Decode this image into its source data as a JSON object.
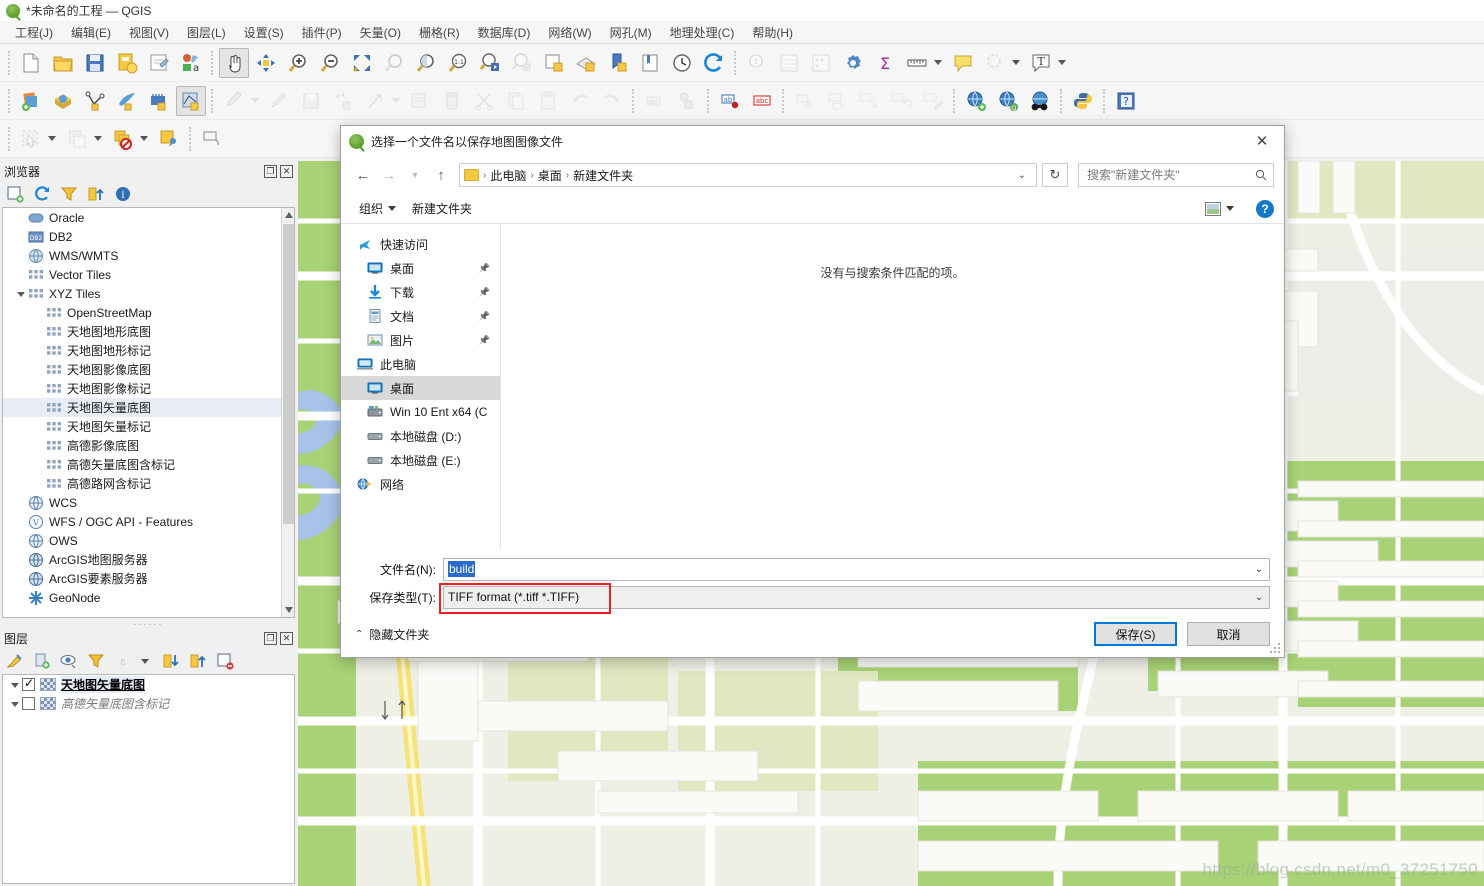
{
  "window": {
    "title": "*未命名的工程 — QGIS",
    "logo_icon": "qgis-logo-icon"
  },
  "menubar": {
    "items": [
      {
        "label": "工程(J)"
      },
      {
        "label": "编辑(E)"
      },
      {
        "label": "视图(V)"
      },
      {
        "label": "图层(L)"
      },
      {
        "label": "设置(S)"
      },
      {
        "label": "插件(P)"
      },
      {
        "label": "矢量(O)"
      },
      {
        "label": "栅格(R)"
      },
      {
        "label": "数据库(D)"
      },
      {
        "label": "网络(W)"
      },
      {
        "label": "网孔(M)"
      },
      {
        "label": "地理处理(C)"
      },
      {
        "label": "帮助(H)"
      }
    ]
  },
  "browser_panel": {
    "title": "浏览器",
    "tools": [
      "add-layer-icon",
      "refresh-icon",
      "filter-icon",
      "collapse-all-icon",
      "info-icon"
    ],
    "items": [
      {
        "label": "Oracle",
        "icon": "oracle-icon",
        "depth": 1,
        "selected": false
      },
      {
        "label": "DB2",
        "icon": "db2-icon",
        "depth": 1,
        "selected": false
      },
      {
        "label": "WMS/WMTS",
        "icon": "wms-icon",
        "depth": 1,
        "selected": false
      },
      {
        "label": "Vector Tiles",
        "icon": "tiles-icon",
        "depth": 1,
        "selected": false
      },
      {
        "label": "XYZ Tiles",
        "icon": "tiles-icon",
        "depth": 1,
        "selected": false,
        "expanded": true
      },
      {
        "label": "OpenStreetMap",
        "icon": "tiles-icon",
        "depth": 2,
        "selected": false
      },
      {
        "label": "天地图地形底图",
        "icon": "tiles-icon",
        "depth": 2,
        "selected": false
      },
      {
        "label": "天地图地形标记",
        "icon": "tiles-icon",
        "depth": 2,
        "selected": false
      },
      {
        "label": "天地图影像底图",
        "icon": "tiles-icon",
        "depth": 2,
        "selected": false
      },
      {
        "label": "天地图影像标记",
        "icon": "tiles-icon",
        "depth": 2,
        "selected": false
      },
      {
        "label": "天地图矢量底图",
        "icon": "tiles-icon",
        "depth": 2,
        "selected": true
      },
      {
        "label": "天地图矢量标记",
        "icon": "tiles-icon",
        "depth": 2,
        "selected": false
      },
      {
        "label": "高德影像底图",
        "icon": "tiles-icon",
        "depth": 2,
        "selected": false
      },
      {
        "label": "高德矢量底图含标记",
        "icon": "tiles-icon",
        "depth": 2,
        "selected": false
      },
      {
        "label": "高德路网含标记",
        "icon": "tiles-icon",
        "depth": 2,
        "selected": false
      },
      {
        "label": "WCS",
        "icon": "globe-icon",
        "depth": 1,
        "selected": false
      },
      {
        "label": "WFS / OGC API - Features",
        "icon": "wfs-icon",
        "depth": 1,
        "selected": false
      },
      {
        "label": "OWS",
        "icon": "globe-icon",
        "depth": 1,
        "selected": false
      },
      {
        "label": "ArcGIS地图服务器",
        "icon": "arcgis-icon",
        "depth": 1,
        "selected": false
      },
      {
        "label": "ArcGIS要素服务器",
        "icon": "arcgis-icon",
        "depth": 1,
        "selected": false
      },
      {
        "label": "GeoNode",
        "icon": "geonode-icon",
        "depth": 1,
        "selected": false
      }
    ]
  },
  "layers_panel": {
    "title": "图层",
    "tools": [
      "style-manager-icon",
      "add-group-icon",
      "visibility-icon",
      "filter-legend-icon",
      "expression-filter-icon",
      "expand-all-icon",
      "collapse-all-icon",
      "remove-layer-icon"
    ],
    "items": [
      {
        "label": "天地图矢量底图",
        "checked": true,
        "selected": true
      },
      {
        "label": "高德矢量底图含标记",
        "checked": false,
        "selected": false
      }
    ]
  },
  "toolbar_rows": {
    "row1_icons": [
      "new-project-icon",
      "open-project-icon",
      "save-project-icon",
      "save-project-as-icon",
      "new-print-layout-icon",
      "style-manager-icon",
      "pan-map-icon",
      "pan-to-selection-icon",
      "zoom-in-icon",
      "zoom-out-icon",
      "zoom-full-icon",
      "zoom-to-selection-icon",
      "zoom-to-layer-icon",
      "zoom-native-icon",
      "zoom-last-icon",
      "zoom-next-icon",
      "new-map-view-icon",
      "new-3d-view-icon",
      "new-bookmark-icon",
      "show-bookmarks-icon",
      "temporal-controller-icon",
      "refresh-map-icon",
      "identify-features-icon",
      "open-attribute-table-icon",
      "statistical-summary-icon",
      "processing-toolbox-icon",
      "sum-icon",
      "measure-line-icon",
      "map-tips-icon",
      "select-by-location-icon",
      "text-annotation-icon"
    ],
    "row2_icons": [
      "data-source-manager-icon",
      "add-raster-layer-icon",
      "add-vector-layer-icon",
      "add-mesh-layer-icon",
      "add-delimited-text-layer-icon",
      "add-wms-layer-icon",
      "current-edits-icon",
      "toggle-editing-icon",
      "save-layer-edits-icon",
      "add-point-feature-icon",
      "vertex-tool-icon",
      "modify-attributes-icon",
      "delete-selected-icon",
      "cut-features-icon",
      "copy-features-icon",
      "paste-features-icon",
      "undo-icon",
      "redo-icon",
      "label-icon",
      "pin-labels-icon",
      "show-hide-labels-icon",
      "highlight-labels-icon",
      "move-label-icon",
      "rotate-label-icon",
      "change-label-icon",
      "metasearch-icon",
      "qgis-server-icon",
      "osm-binoculars-icon",
      "python-console-icon",
      "help-icon"
    ],
    "row3_icons": [
      "deselect-features-icon",
      "select-features-icon",
      "select-by-expression-icon",
      "open-field-calculator-icon",
      "measure-area-icon"
    ]
  },
  "dialog": {
    "title": "选择一个文件名以保存地图图像文件",
    "close_icon": "close-icon",
    "nav": {
      "back_icon": "arrow-left-icon",
      "forward_icon": "arrow-right-icon",
      "recent_icon": "chevron-down-icon",
      "up_icon": "arrow-up-icon",
      "refresh_icon": "refresh-icon",
      "dropdown_icon": "chevron-down-icon"
    },
    "breadcrumb": {
      "folder_icon": "folder-icon",
      "parts": [
        "此电脑",
        "桌面",
        "新建文件夹"
      ]
    },
    "search": {
      "placeholder": "搜索\"新建文件夹\"",
      "value": "",
      "icon": "search-icon"
    },
    "commands": {
      "organize": "组织",
      "new_folder": "新建文件夹",
      "view_icon": "view-layout-icon",
      "view_caret_icon": "chevron-down-icon",
      "help_label": "?"
    },
    "sidebar": [
      {
        "label": "快速访问",
        "icon": "quick-access-star-icon",
        "indent": false,
        "pinned": false,
        "selected": false
      },
      {
        "label": "桌面",
        "icon": "desktop-icon",
        "indent": true,
        "pinned": true,
        "selected": false
      },
      {
        "label": "下载",
        "icon": "downloads-icon",
        "indent": true,
        "pinned": true,
        "selected": false
      },
      {
        "label": "文档",
        "icon": "documents-icon",
        "indent": true,
        "pinned": true,
        "selected": false
      },
      {
        "label": "图片",
        "icon": "pictures-icon",
        "indent": true,
        "pinned": true,
        "selected": false
      },
      {
        "label": "此电脑",
        "icon": "this-pc-icon",
        "indent": false,
        "pinned": false,
        "selected": false
      },
      {
        "label": "桌面",
        "icon": "desktop-icon",
        "indent": true,
        "pinned": false,
        "selected": true
      },
      {
        "label": "Win 10 Ent x64 (C",
        "icon": "system-drive-icon",
        "indent": true,
        "pinned": false,
        "selected": false
      },
      {
        "label": "本地磁盘 (D:)",
        "icon": "drive-icon",
        "indent": true,
        "pinned": false,
        "selected": false
      },
      {
        "label": "本地磁盘 (E:)",
        "icon": "drive-icon",
        "indent": true,
        "pinned": false,
        "selected": false
      },
      {
        "label": "网络",
        "icon": "network-icon",
        "indent": false,
        "pinned": false,
        "selected": false
      }
    ],
    "file_list": {
      "empty_message": "没有与搜索条件匹配的项。"
    },
    "fields": {
      "filename_label": "文件名(N):",
      "filename_value": "build",
      "filetype_label": "保存类型(T):",
      "filetype_value": "TIFF format (*.tiff *.TIFF)",
      "caret_icon": "chevron-down-icon"
    },
    "footer": {
      "hide_folders_label": "隐藏文件夹",
      "hide_folders_icon": "chevron-up-icon",
      "save_label": "保存(S)",
      "cancel_label": "取消"
    },
    "annotation": {
      "highlight_color": "#ee2222"
    }
  },
  "map": {
    "watermark": "https://blog.csdn.net/m0_37251750",
    "colors": {
      "land": "#eef0e6",
      "green": "#a8d275",
      "green_light": "#dfe8c0",
      "water": "#a8c3e8",
      "road_white": "#ffffff",
      "road_yellow": "#f5e27a",
      "building": "#f2f2ee"
    }
  },
  "theme": {
    "accent": "#0078d7",
    "panel_bg": "#f0f0f0",
    "toolbar_bg": "#f6f6f6",
    "selection_blue": "#2a6ac8"
  }
}
